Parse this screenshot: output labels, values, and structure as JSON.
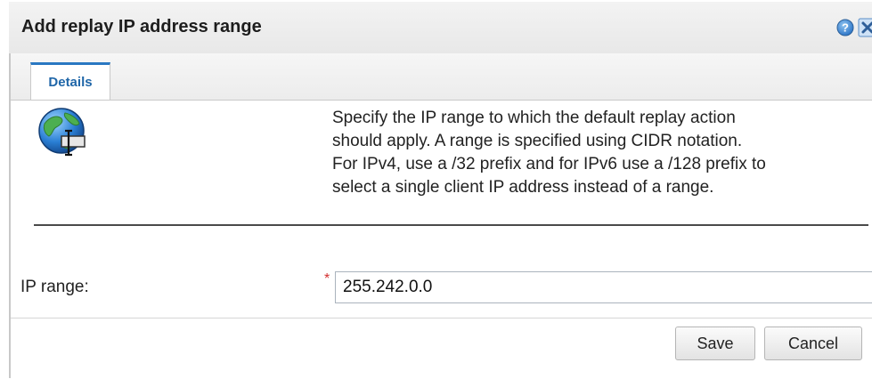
{
  "dialog": {
    "title": "Add replay IP address range",
    "help_icon": "help-icon",
    "close_icon": "close-icon"
  },
  "tabs": [
    {
      "label": "Details",
      "active": true
    }
  ],
  "details": {
    "icon": "globe-with-cursor-icon",
    "description_lines": [
      "Specify the IP range to which the default replay action",
      "should apply. A range is specified using CIDR notation.",
      "For IPv4, use a /32 prefix and for IPv6 use a /128 prefix to",
      "select a single client IP address instead of a range."
    ]
  },
  "form": {
    "ip_range": {
      "label": "IP range:",
      "required_marker": "*",
      "value": "255.242.0.0"
    }
  },
  "buttons": {
    "save": "Save",
    "cancel": "Cancel"
  },
  "colors": {
    "accent": "#2a78c2",
    "required": "#d32f2f"
  }
}
